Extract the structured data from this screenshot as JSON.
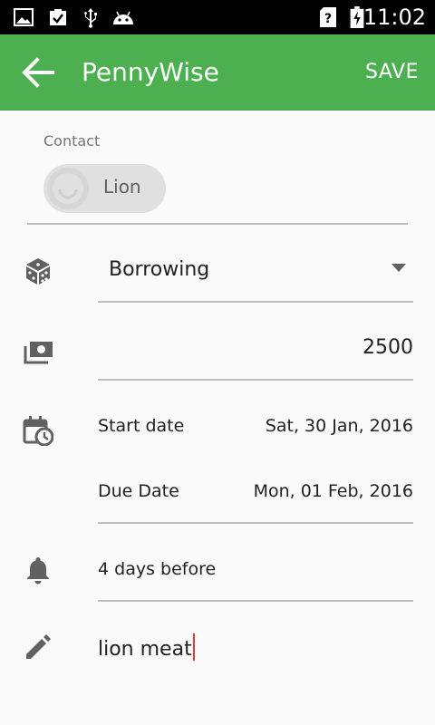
{
  "status_bar": {
    "time": "11:02",
    "left_icons": [
      "image-icon",
      "briefcase-check-icon",
      "usb-icon",
      "android-icon"
    ],
    "right_icons": [
      "sim-unknown-icon",
      "battery-charging-icon"
    ]
  },
  "app_bar": {
    "title": "PennyWise",
    "action": "SAVE",
    "color": "#4caf50"
  },
  "form": {
    "contact_label": "Contact",
    "contact_chip": "Lion",
    "type_value": "Borrowing",
    "amount": "2500",
    "start_date_label": "Start date",
    "start_date_value": "Sat, 30 Jan, 2016",
    "due_date_label": "Due Date",
    "due_date_value": "Mon, 01 Feb, 2016",
    "reminder": "4 days before",
    "note": "lion meat"
  },
  "colors": {
    "cursor": "#e53935",
    "icon": "#616161"
  }
}
